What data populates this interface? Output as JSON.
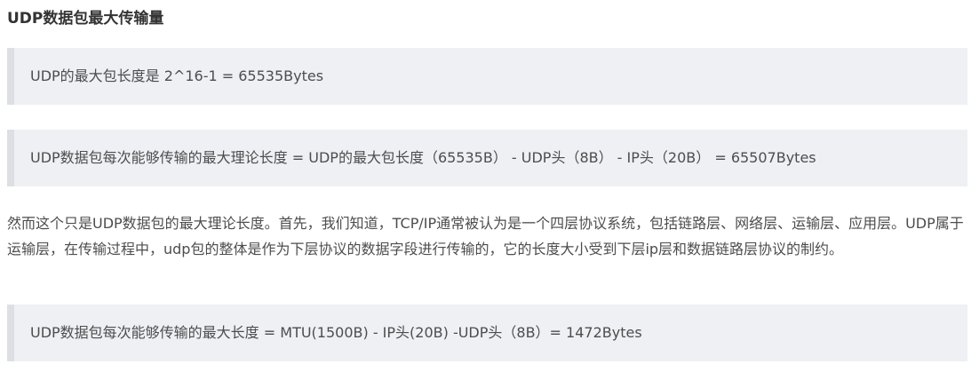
{
  "article": {
    "heading": "UDP数据包最大传输量",
    "quotes": [
      "UDP的最大包长度是 2^16-1 = 65535Bytes",
      "UDP数据包每次能够传输的最大理论长度 = UDP的最大包长度（65535B） - UDP头（8B） - IP头（20B） = 65507Bytes",
      "UDP数据包每次能够传输的最大长度 = MTU(1500B) - IP头(20B) -UDP头（8B）= 1472Bytes"
    ],
    "paragraph": "然而这个只是UDP数据包的最大理论长度。首先，我们知道，TCP/IP通常被认为是一个四层协议系统，包括链路层、网络层、运输层、应用层。UDP属于运输层，在传输过程中，udp包的整体是作为下层协议的数据字段进行传输的，它的长度大小受到下层ip层和数据链路层协议的制约。"
  }
}
